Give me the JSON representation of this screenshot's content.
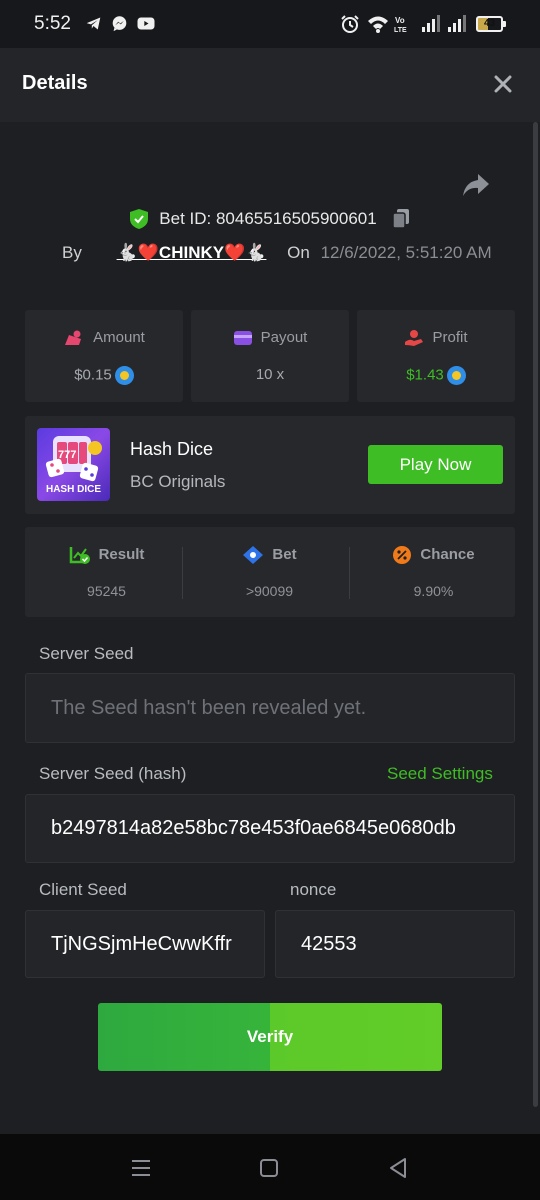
{
  "status_bar": {
    "time": "5:52",
    "app_icons": [
      "telegram-icon",
      "messenger-icon",
      "youtube-icon"
    ],
    "battery": "43"
  },
  "header": {
    "title": "Details"
  },
  "bet": {
    "id_label": "Bet ID: 80465516505900601",
    "by_label": "By",
    "username": "🐇❤️CHINKY❤️🐇",
    "on_label": "On",
    "datetime": "12/6/2022, 5:51:20 AM"
  },
  "stats": {
    "amount_label": "Amount",
    "amount_value": "$0.15",
    "payout_label": "Payout",
    "payout_value": "10 x",
    "profit_label": "Profit",
    "profit_value": "$1.43"
  },
  "game": {
    "thumb_label": "HASH DICE",
    "name": "Hash Dice",
    "provider": "BC Originals",
    "play_label": "Play Now"
  },
  "result_panel": {
    "result_label": "Result",
    "result_value": "95245",
    "bet_label": "Bet",
    "bet_value": ">90099",
    "chance_label": "Chance",
    "chance_value": "9.90%"
  },
  "fairness": {
    "server_seed_label": "Server Seed",
    "server_seed_value": "The Seed hasn't been revealed yet.",
    "server_hash_label": "Server Seed (hash)",
    "seed_settings_label": "Seed Settings",
    "server_hash_value": "b2497814a82e58bc78e453f0ae6845e0680db",
    "client_seed_label": "Client Seed",
    "client_seed_value": "TjNGSjmHeCwwKffr",
    "nonce_label": "nonce",
    "nonce_value": "42553",
    "verify_label": "Verify"
  },
  "colors": {
    "accent_green": "#3fbd25",
    "background": "#1d1f22",
    "card": "#26282c"
  }
}
